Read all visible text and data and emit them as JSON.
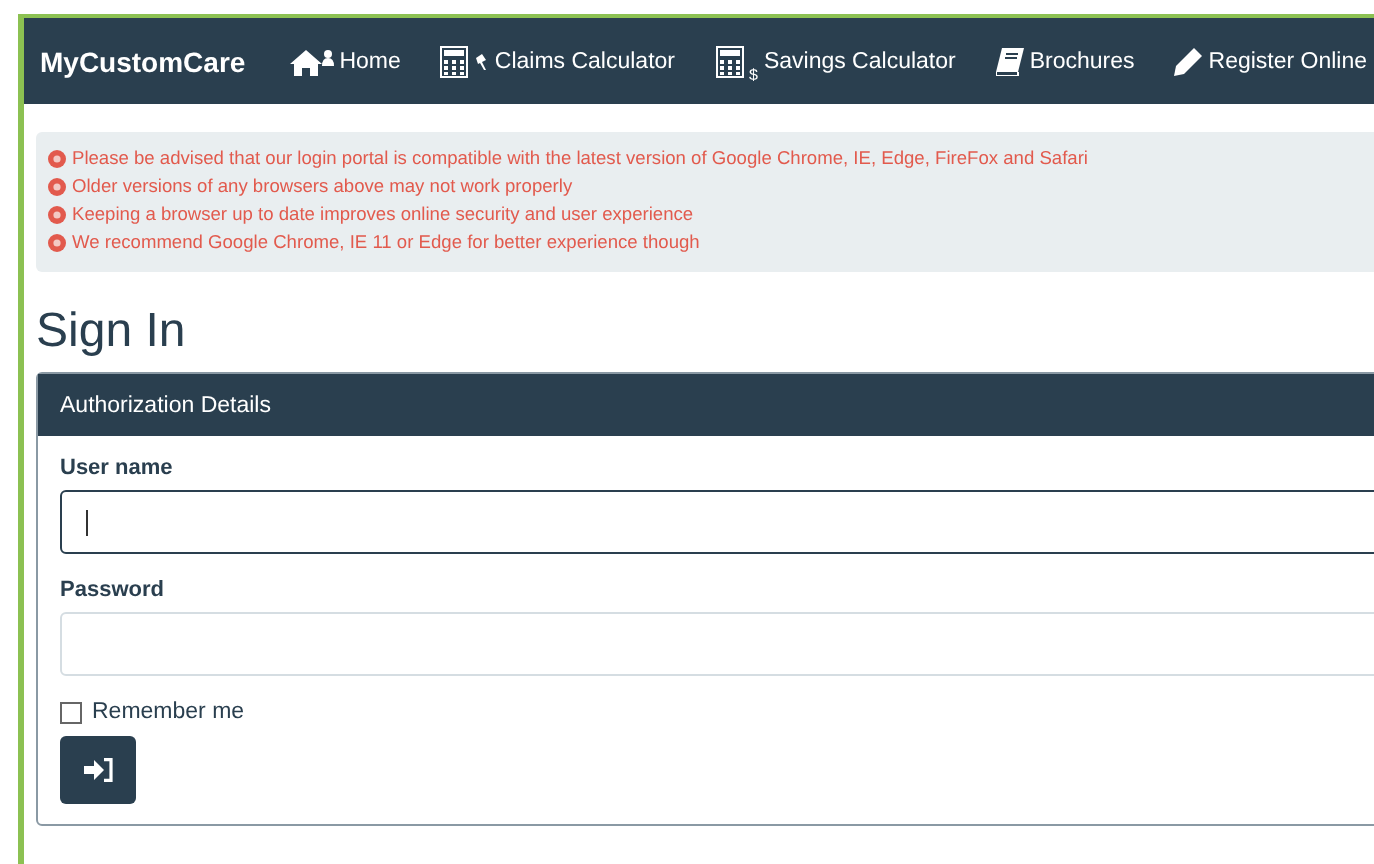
{
  "navbar": {
    "brand": "MyCustomCare",
    "items": [
      {
        "kind": "home",
        "label": "Home"
      },
      {
        "kind": "claims",
        "label": "Claims Calculator"
      },
      {
        "kind": "savings",
        "sup": "$",
        "label": "Savings Calculator"
      },
      {
        "kind": "book",
        "label": "Brochures"
      },
      {
        "kind": "pencil",
        "label": "Register Online"
      }
    ]
  },
  "notice": [
    "Please be advised that our login portal is compatible with the latest version of Google Chrome, IE, Edge, FireFox and Safari",
    "Older versions of any browsers above may not work properly",
    "Keeping a browser up to date improves online security and user experience",
    "We recommend Google Chrome, IE 11 or Edge for better experience though"
  ],
  "title": "Sign In",
  "panel": {
    "header": "Authorization Details",
    "fields": [
      {
        "label": "User name",
        "focused": true
      },
      {
        "label": "Password",
        "focused": false
      }
    ],
    "remember": {
      "label": "Remember me",
      "checked": false
    }
  }
}
